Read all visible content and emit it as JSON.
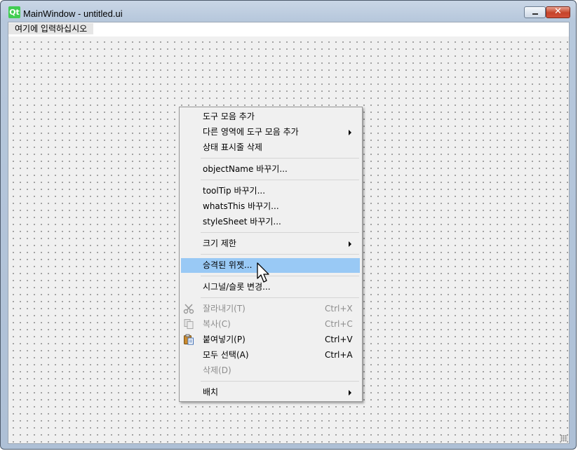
{
  "window": {
    "title": "MainWindow - untitled.ui",
    "logo_text": "Qt"
  },
  "menubar": {
    "item": "여기에 입력하십시오"
  },
  "context_menu": {
    "items": [
      {
        "label": "도구 모음 추가"
      },
      {
        "label": "다른 영역에 도구 모음 추가",
        "submenu": true
      },
      {
        "label": "상태 표시줄 삭제"
      },
      {
        "label": "objectName 바꾸기..."
      },
      {
        "label": "toolTip 바꾸기..."
      },
      {
        "label": "whatsThis 바꾸기..."
      },
      {
        "label": "styleSheet 바꾸기..."
      },
      {
        "label": "크기 제한",
        "submenu": true
      },
      {
        "label": "승격된 위젯...",
        "highlighted": true
      },
      {
        "label": "시그널/슬롯 변경..."
      },
      {
        "label": "잘라내기(T)",
        "shortcut": "Ctrl+X",
        "disabled": true,
        "icon": "scissors-icon"
      },
      {
        "label": "복사(C)",
        "shortcut": "Ctrl+C",
        "disabled": true,
        "icon": "copy-icon"
      },
      {
        "label": "붙여넣기(P)",
        "shortcut": "Ctrl+V",
        "icon": "paste-icon"
      },
      {
        "label": "모두 선택(A)",
        "shortcut": "Ctrl+A"
      },
      {
        "label": "삭제(D)",
        "disabled": true
      },
      {
        "label": "배치",
        "submenu": true
      }
    ]
  },
  "colors": {
    "highlight": "#99c9f5",
    "menu_background": "#f0f0f0",
    "disabled_text": "#8d8d8d",
    "close_button": "#c6442a"
  }
}
